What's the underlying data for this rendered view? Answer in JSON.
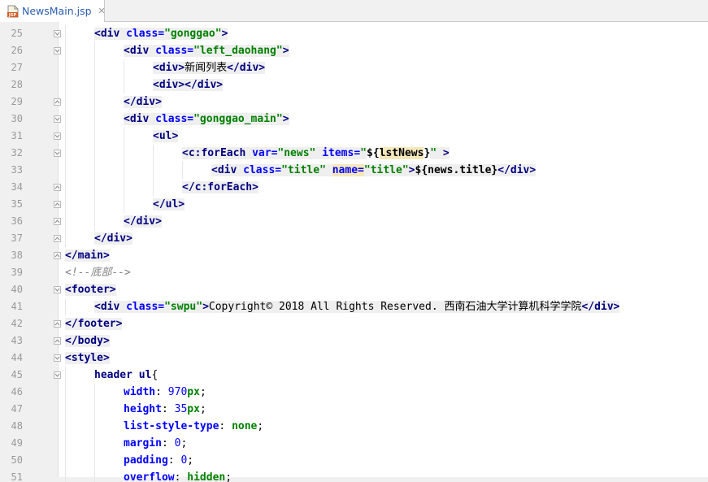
{
  "tab": {
    "title": "NewsMain.jsp",
    "close": "✕",
    "icon": "jsp-file-icon"
  },
  "lines": [
    {
      "n": "25",
      "indent": 1,
      "fold": "open",
      "segs": [
        {
          "c": "t-tag",
          "t": "<div "
        },
        {
          "c": "t-attr",
          "t": "class="
        },
        {
          "c": "t-val",
          "t": "\"gonggao\""
        },
        {
          "c": "t-tag",
          "t": ">"
        }
      ]
    },
    {
      "n": "26",
      "indent": 2,
      "fold": "open",
      "segs": [
        {
          "c": "t-tag",
          "t": "<div "
        },
        {
          "c": "t-attr",
          "t": "class="
        },
        {
          "c": "t-val",
          "t": "\"left_daohang\""
        },
        {
          "c": "t-tag",
          "t": ">"
        }
      ]
    },
    {
      "n": "27",
      "indent": 3,
      "fold": "",
      "segs": [
        {
          "c": "t-tag",
          "t": "<div>"
        },
        {
          "c": "t-plain-bg cjk",
          "t": "新闻列表"
        },
        {
          "c": "t-tag",
          "t": "</div>"
        }
      ]
    },
    {
      "n": "28",
      "indent": 3,
      "fold": "",
      "segs": [
        {
          "c": "t-tag",
          "t": "<div></div>"
        }
      ]
    },
    {
      "n": "29",
      "indent": 2,
      "fold": "close",
      "segs": [
        {
          "c": "t-tag",
          "t": "</div>"
        }
      ]
    },
    {
      "n": "30",
      "indent": 2,
      "fold": "open",
      "segs": [
        {
          "c": "t-tag",
          "t": "<div "
        },
        {
          "c": "t-attr",
          "t": "class="
        },
        {
          "c": "t-val",
          "t": "\"gonggao_main\""
        },
        {
          "c": "t-tag",
          "t": ">"
        }
      ]
    },
    {
      "n": "31",
      "indent": 3,
      "fold": "open",
      "segs": [
        {
          "c": "t-tag",
          "t": "<ul>"
        }
      ]
    },
    {
      "n": "32",
      "indent": 4,
      "fold": "open",
      "segs": [
        {
          "c": "t-tag",
          "t": "<c:forEach "
        },
        {
          "c": "t-attr",
          "t": "var="
        },
        {
          "c": "t-val",
          "t": "\"news\""
        },
        {
          "c": "t-tag",
          "t": " "
        },
        {
          "c": "t-attr",
          "t": "items="
        },
        {
          "c": "t-val",
          "t": "\""
        },
        {
          "c": "t-el",
          "t": "${"
        },
        {
          "c": "t-el t-hl",
          "t": "lstNews"
        },
        {
          "c": "t-el",
          "t": "}"
        },
        {
          "c": "t-val",
          "t": "\""
        },
        {
          "c": "t-tag",
          "t": " >"
        }
      ]
    },
    {
      "n": "33",
      "indent": 5,
      "fold": "",
      "segs": [
        {
          "c": "t-tag",
          "t": "<div "
        },
        {
          "c": "t-attr",
          "t": "class="
        },
        {
          "c": "t-val",
          "t": "\"title\""
        },
        {
          "c": "t-tag",
          "t": " "
        },
        {
          "c": "t-attr t-hl",
          "t": "name="
        },
        {
          "c": "t-val",
          "t": "\"title\""
        },
        {
          "c": "t-tag",
          "t": ">"
        },
        {
          "c": "t-el t-plain-bg",
          "t": "${news.title}"
        },
        {
          "c": "t-tag",
          "t": "</div>"
        }
      ]
    },
    {
      "n": "34",
      "indent": 4,
      "fold": "close",
      "segs": [
        {
          "c": "t-tag",
          "t": "</c:forEach>"
        }
      ]
    },
    {
      "n": "35",
      "indent": 3,
      "fold": "close",
      "segs": [
        {
          "c": "t-tag",
          "t": "</ul>"
        }
      ]
    },
    {
      "n": "36",
      "indent": 2,
      "fold": "close",
      "segs": [
        {
          "c": "t-tag",
          "t": "</div>"
        }
      ]
    },
    {
      "n": "37",
      "indent": 1,
      "fold": "close",
      "segs": [
        {
          "c": "t-tag",
          "t": "</div>"
        }
      ]
    },
    {
      "n": "38",
      "indent": 0,
      "fold": "close",
      "segs": [
        {
          "c": "t-tag",
          "t": "</main>"
        }
      ]
    },
    {
      "n": "39",
      "indent": 0,
      "fold": "",
      "segs": [
        {
          "c": "t-comment",
          "t": "<!--"
        },
        {
          "c": "t-comment cjk",
          "t": "底部"
        },
        {
          "c": "t-comment",
          "t": "-->"
        }
      ]
    },
    {
      "n": "40",
      "indent": 0,
      "fold": "open",
      "segs": [
        {
          "c": "t-tag",
          "t": "<footer>"
        }
      ]
    },
    {
      "n": "41",
      "indent": 1,
      "fold": "",
      "segs": [
        {
          "c": "t-tag",
          "t": "<div "
        },
        {
          "c": "t-attr",
          "t": "class="
        },
        {
          "c": "t-val",
          "t": "\"swpu\""
        },
        {
          "c": "t-tag",
          "t": ">"
        },
        {
          "c": "t-text t-plain-bg",
          "t": "Copyright© 2018 All Rights Reserved. "
        },
        {
          "c": "t-text t-plain-bg cjk",
          "t": "西南石油大学计算机科学学院"
        },
        {
          "c": "t-tag",
          "t": "</div>"
        }
      ]
    },
    {
      "n": "42",
      "indent": 0,
      "fold": "close",
      "segs": [
        {
          "c": "t-tag",
          "t": "</footer>"
        }
      ]
    },
    {
      "n": "43",
      "indent": 0,
      "fold": "close",
      "segs": [
        {
          "c": "t-tag",
          "t": "</body>"
        }
      ]
    },
    {
      "n": "44",
      "indent": 0,
      "fold": "open",
      "segs": [
        {
          "c": "t-tag",
          "t": "<style>"
        }
      ]
    },
    {
      "n": "45",
      "indent": 1,
      "fold": "open",
      "segs": [
        {
          "c": "t-sel",
          "t": "header ul"
        },
        {
          "c": "t-text",
          "t": "{"
        }
      ]
    },
    {
      "n": "46",
      "indent": 2,
      "fold": "",
      "segs": [
        {
          "c": "t-prop",
          "t": "width"
        },
        {
          "c": "t-text",
          "t": ": "
        },
        {
          "c": "t-num",
          "t": "970"
        },
        {
          "c": "t-kw",
          "t": "px"
        },
        {
          "c": "t-text",
          "t": ";"
        }
      ]
    },
    {
      "n": "47",
      "indent": 2,
      "fold": "",
      "segs": [
        {
          "c": "t-prop",
          "t": "height"
        },
        {
          "c": "t-text",
          "t": ": "
        },
        {
          "c": "t-num",
          "t": "35"
        },
        {
          "c": "t-kw",
          "t": "px"
        },
        {
          "c": "t-text",
          "t": ";"
        }
      ]
    },
    {
      "n": "48",
      "indent": 2,
      "fold": "",
      "segs": [
        {
          "c": "t-prop",
          "t": "list-style-type"
        },
        {
          "c": "t-text",
          "t": ": "
        },
        {
          "c": "t-kw",
          "t": "none"
        },
        {
          "c": "t-text",
          "t": ";"
        }
      ]
    },
    {
      "n": "49",
      "indent": 2,
      "fold": "",
      "segs": [
        {
          "c": "t-prop",
          "t": "margin"
        },
        {
          "c": "t-text",
          "t": ": "
        },
        {
          "c": "t-num",
          "t": "0"
        },
        {
          "c": "t-text",
          "t": ";"
        }
      ]
    },
    {
      "n": "50",
      "indent": 2,
      "fold": "",
      "segs": [
        {
          "c": "t-prop",
          "t": "padding"
        },
        {
          "c": "t-text",
          "t": ": "
        },
        {
          "c": "t-num",
          "t": "0"
        },
        {
          "c": "t-text",
          "t": ";"
        }
      ]
    },
    {
      "n": "51",
      "indent": 2,
      "fold": "",
      "segs": [
        {
          "c": "t-prop",
          "t": "overflow"
        },
        {
          "c": "t-text",
          "t": ": "
        },
        {
          "c": "t-kw",
          "t": "hidden"
        },
        {
          "c": "t-text",
          "t": ";"
        }
      ]
    }
  ]
}
